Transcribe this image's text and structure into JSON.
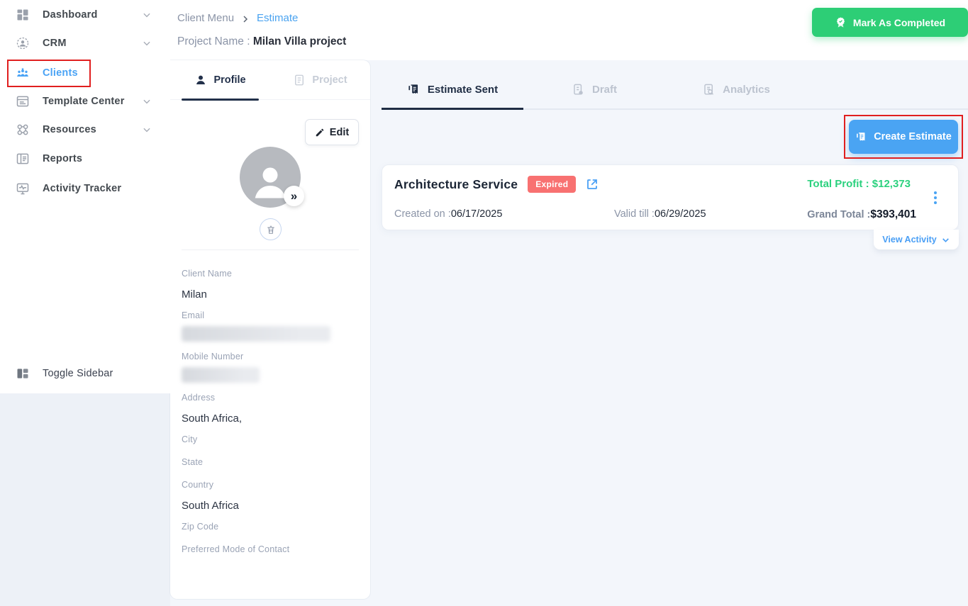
{
  "sidebar": {
    "items": [
      {
        "label": "Dashboard",
        "icon": "dashboard-icon",
        "chevron": true,
        "active": false
      },
      {
        "label": "CRM",
        "icon": "crm-icon",
        "chevron": true,
        "active": false
      },
      {
        "label": "Clients",
        "icon": "clients-icon",
        "chevron": false,
        "active": true
      },
      {
        "label": "Template Center",
        "icon": "template-center-icon",
        "chevron": true,
        "active": false
      },
      {
        "label": "Resources",
        "icon": "resources-icon",
        "chevron": true,
        "active": false
      },
      {
        "label": "Reports",
        "icon": "reports-icon",
        "chevron": false,
        "active": false
      },
      {
        "label": "Activity Tracker",
        "icon": "activity-tracker-icon",
        "chevron": false,
        "active": false
      }
    ],
    "toggle_label": "Toggle Sidebar"
  },
  "header": {
    "breadcrumb": {
      "parent": "Client Menu",
      "current": "Estimate"
    },
    "project_label": "Project Name :",
    "project_name": "Milan Villa project",
    "mark_completed_label": "Mark As Completed"
  },
  "profile_card": {
    "tabs": {
      "profile": "Profile",
      "project": "Project"
    },
    "edit_label": "Edit",
    "fields": {
      "client_name": {
        "label": "Client Name",
        "value": "Milan"
      },
      "email": {
        "label": "Email",
        "value": "",
        "redacted": true
      },
      "mobile": {
        "label": "Mobile Number",
        "value": "",
        "redacted": true
      },
      "address": {
        "label": "Address",
        "value": "South Africa,"
      },
      "city": {
        "label": "City",
        "value": ""
      },
      "state": {
        "label": "State",
        "value": ""
      },
      "country": {
        "label": "Country",
        "value": "South Africa"
      },
      "zip": {
        "label": "Zip Code",
        "value": ""
      },
      "preferred": {
        "label": "Preferred Mode of Contact",
        "value": ""
      }
    }
  },
  "main": {
    "tabs": {
      "estimate_sent": "Estimate Sent",
      "draft": "Draft",
      "analytics": "Analytics"
    },
    "create_estimate_label": "Create Estimate",
    "estimate": {
      "title": "Architecture Service",
      "status": "Expired",
      "total_profit_label": "Total Profit : ",
      "total_profit_value": "$12,373",
      "created_label": "Created on :",
      "created_value": "06/17/2025",
      "valid_label": "Valid till :",
      "valid_value": "06/29/2025",
      "grand_total_label": "Grand Total :",
      "grand_total_value": "$393,401",
      "view_activity_label": "View Activity"
    }
  },
  "colors": {
    "accent_blue": "#4aa4f3",
    "success_green": "#2dce76",
    "profit_green": "#2bd17e",
    "expired_red": "#f87171",
    "annotation_red": "#e01f1f",
    "navy": "#1f2d44",
    "content_bg": "#f3f6fb"
  }
}
